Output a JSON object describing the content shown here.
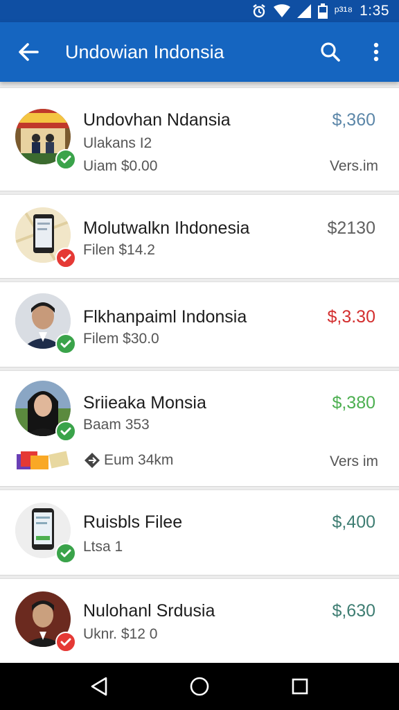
{
  "status_bar": {
    "extra": "ᵖ³¹⁸",
    "time": "1:35"
  },
  "app_bar": {
    "title": "Undowian Indonsia"
  },
  "items": [
    {
      "name": "Undovhan Ndansia",
      "line1": "Ulakans I2",
      "line2": "Uiam $0.00",
      "price": "$,360",
      "price_color": "#5b86a8",
      "right_extra": "Vers.im",
      "status": "ok"
    },
    {
      "name": "Molutwalkn Ihdonesia",
      "line1": "Filen $14.2",
      "price": "$2130",
      "price_color": "#606060",
      "status": "err"
    },
    {
      "name": "Flkhanpaiml Indonsia",
      "line1": "Filem $30.0",
      "price": "$,3.30",
      "price_color": "#d32f2f",
      "status": "ok"
    },
    {
      "name": "Sriieaka Monsia",
      "line1": "Baam 353",
      "line2": "Eum 34km",
      "price": "$,380",
      "price_color": "#4caf50",
      "right_extra": "Vers im",
      "status": "ok"
    },
    {
      "name": "Ruisbls Filee",
      "line1": "Ltsa 1",
      "price": "$,400",
      "price_color": "#3e7d72",
      "status": "ok"
    },
    {
      "name": "Nulohanl Srdusia",
      "line1": "Uknr. $12 0",
      "price": "$,630",
      "price_color": "#3e7d72",
      "status": "err"
    }
  ],
  "colors": {
    "primary": "#1565c0",
    "status_bar": "#0f4fa3",
    "ok": "#3aa34a",
    "err": "#e53935"
  }
}
